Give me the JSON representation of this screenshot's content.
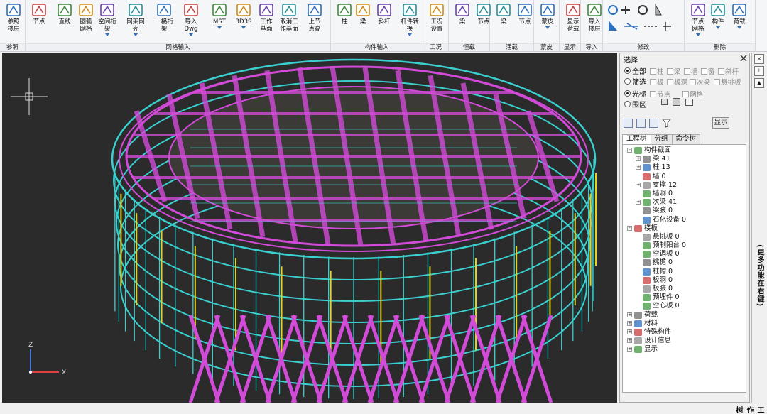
{
  "ribbon": {
    "groups": [
      {
        "label": "参照",
        "buttons": [
          {
            "label": "参照\n楼层",
            "icon": "reference-floor-icon"
          }
        ]
      },
      {
        "label": "网格输入",
        "buttons": [
          {
            "label": "节点",
            "icon": "node-icon"
          },
          {
            "label": "直线",
            "icon": "line-icon"
          },
          {
            "label": "圆弧\n网格",
            "icon": "arc-grid-icon"
          },
          {
            "label": "空间桁架",
            "icon": "space-truss-icon"
          },
          {
            "label": "网架网壳",
            "icon": "grid-shell-icon"
          },
          {
            "label": "一榀桁架",
            "icon": "planar-truss-icon"
          },
          {
            "label": "导入Dwg",
            "icon": "import-dwg-icon"
          },
          {
            "label": "MST",
            "icon": "mst-icon"
          },
          {
            "label": "3D3S",
            "icon": "3d3s-icon"
          },
          {
            "label": "工作\n基面",
            "icon": "work-plane-icon"
          },
          {
            "label": "取消工\n作基面",
            "icon": "cancel-work-plane-icon"
          },
          {
            "label": "上节\n点高",
            "icon": "node-height-icon"
          }
        ]
      },
      {
        "label": "构件输入",
        "buttons": [
          {
            "label": "柱",
            "icon": "column-icon"
          },
          {
            "label": "梁",
            "icon": "beam-icon"
          },
          {
            "label": "斜杆",
            "icon": "brace-icon"
          },
          {
            "label": "杆件转换",
            "icon": "member-convert-icon"
          }
        ]
      },
      {
        "label": "工况",
        "buttons": [
          {
            "label": "工况\n设置",
            "icon": "load-case-icon"
          }
        ]
      },
      {
        "label": "恒载",
        "buttons": [
          {
            "label": "梁",
            "icon": "dead-beam-icon"
          },
          {
            "label": "节点",
            "icon": "dead-node-icon"
          }
        ]
      },
      {
        "label": "活载",
        "buttons": [
          {
            "label": "梁",
            "icon": "live-beam-icon"
          },
          {
            "label": "节点",
            "icon": "live-node-icon"
          }
        ]
      },
      {
        "label": "蒙皮",
        "buttons": [
          {
            "label": "蒙皮",
            "icon": "skin-icon"
          }
        ]
      },
      {
        "label": "显示",
        "buttons": [
          {
            "label": "显示\n荷载",
            "icon": "show-load-icon"
          }
        ]
      },
      {
        "label": "导入",
        "buttons": [
          {
            "label": "导入\n楼层",
            "icon": "import-floor-icon"
          }
        ]
      },
      {
        "label": "修改",
        "buttons": [
          {
            "label": "",
            "icon": "modify-tools-icon"
          }
        ]
      },
      {
        "label": "删除",
        "buttons": [
          {
            "label": "节点\n网格",
            "icon": "delete-node-grid-icon"
          },
          {
            "label": "构件",
            "icon": "delete-member-icon"
          },
          {
            "label": "荷载",
            "icon": "delete-load-icon"
          }
        ]
      }
    ]
  },
  "panel": {
    "title": "选择",
    "radios": [
      {
        "label": "全部",
        "selected": true
      },
      {
        "label": "筛选",
        "selected": false
      },
      {
        "label": "光标",
        "selected": true
      },
      {
        "label": "围区",
        "selected": false
      }
    ],
    "filters_row1": [
      "柱",
      "梁",
      "墙",
      "窗",
      "斜杆"
    ],
    "filters_row2": [
      "板",
      "板洞",
      "次梁",
      "悬挑板"
    ],
    "filters_row3": [
      "节点",
      "网格"
    ],
    "show_button": "显示",
    "tabs": [
      "工程树",
      "分组",
      "命令树"
    ],
    "tree": [
      {
        "level": 0,
        "pm": "-",
        "icon": "section-icon",
        "text": "构件截面"
      },
      {
        "level": 1,
        "pm": "+",
        "icon": "beam-tree-icon",
        "text": "梁 41"
      },
      {
        "level": 1,
        "pm": "+",
        "icon": "column-tree-icon",
        "text": "柱 13"
      },
      {
        "level": 1,
        "pm": "",
        "icon": "wall-tree-icon",
        "text": "墙 0"
      },
      {
        "level": 1,
        "pm": "+",
        "icon": "brace-tree-icon",
        "text": "支撑 12"
      },
      {
        "level": 1,
        "pm": "",
        "icon": "wall-opening-icon",
        "text": "墙洞 0"
      },
      {
        "level": 1,
        "pm": "+",
        "icon": "secondary-beam-icon",
        "text": "次梁 41"
      },
      {
        "level": 1,
        "pm": "",
        "icon": "haunch-icon",
        "text": "梁腋 0"
      },
      {
        "level": 1,
        "pm": "",
        "icon": "petro-equipment-icon",
        "text": "石化设备 0"
      },
      {
        "level": 0,
        "pm": "-",
        "icon": "slab-icon",
        "text": "楼板"
      },
      {
        "level": 1,
        "pm": "",
        "icon": "cantilever-icon",
        "text": "悬挑板 0"
      },
      {
        "level": 1,
        "pm": "",
        "icon": "precast-balcony-icon",
        "text": "预制阳台 0"
      },
      {
        "level": 1,
        "pm": "",
        "icon": "ac-slab-icon",
        "text": "空调板 0"
      },
      {
        "level": 1,
        "pm": "",
        "icon": "eave-icon",
        "text": "挑檐 0"
      },
      {
        "level": 1,
        "pm": "",
        "icon": "column-cap-icon",
        "text": "柱帽 0"
      },
      {
        "level": 1,
        "pm": "",
        "icon": "slab-opening-icon",
        "text": "板洞 0"
      },
      {
        "level": 1,
        "pm": "",
        "icon": "slab-haunch-icon",
        "text": "板腋 0"
      },
      {
        "level": 1,
        "pm": "",
        "icon": "embedded-part-icon",
        "text": "预埋件 0"
      },
      {
        "level": 1,
        "pm": "",
        "icon": "hollow-slab-icon",
        "text": "空心板 0"
      },
      {
        "level": 0,
        "pm": "+",
        "icon": "load-tree-icon",
        "text": "荷载"
      },
      {
        "level": 0,
        "pm": "+",
        "icon": "material-icon",
        "text": "材料"
      },
      {
        "level": 0,
        "pm": "+",
        "icon": "sp-icon",
        "text": "特殊构件"
      },
      {
        "level": 0,
        "pm": "+",
        "icon": "design-info-icon",
        "text": "设计信息"
      },
      {
        "level": 0,
        "pm": "+",
        "icon": "display-tree-icon",
        "text": "显示"
      }
    ]
  },
  "sidebar": {
    "label_top": "(更多功能在右键)",
    "label_bottom": "工作树"
  },
  "viewport": {
    "axis_z": "Z",
    "axis_x": "X"
  },
  "colors": {
    "truss_cyan": "#3ad0d0",
    "truss_magenta": "#d24bd8",
    "background": "#2b2b2b",
    "columns_yellow": "#e6d21a"
  }
}
